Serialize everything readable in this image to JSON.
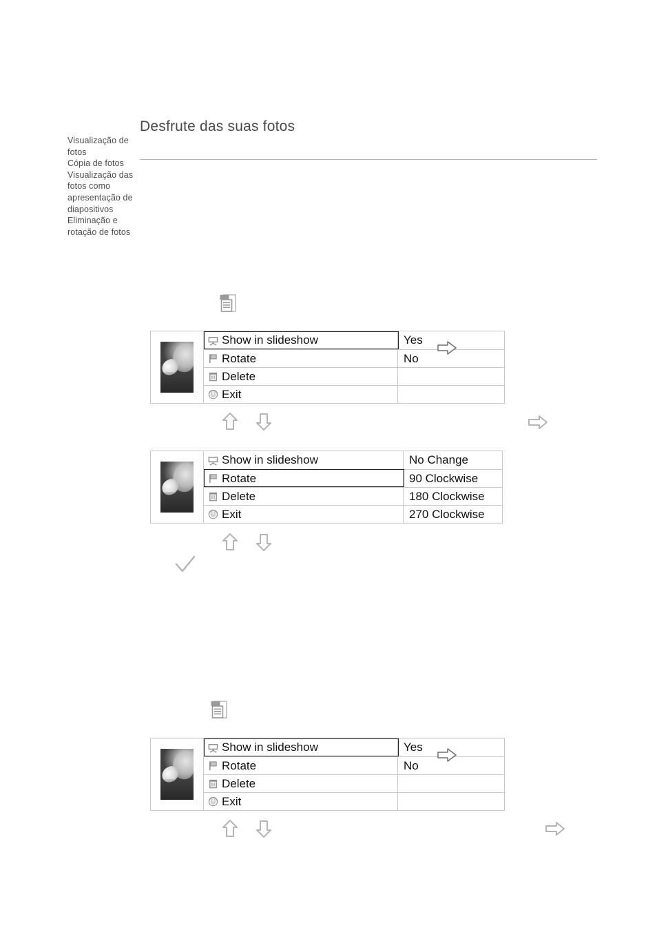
{
  "header": {
    "title": "Desfrute das suas fotos"
  },
  "sidebar": {
    "items": [
      {
        "label": "Visualização de fotos"
      },
      {
        "label": "Cópia de fotos"
      },
      {
        "label": "Visualização das fotos como apresentação de diapositivos"
      },
      {
        "label": "Eliminação e rotação de fotos"
      }
    ]
  },
  "colors": {
    "text_dark": "#111111",
    "title_gray": "#4a4a4a",
    "sidebar_gray": "#4c4c4c",
    "table_border": "#c8c8c8",
    "selection_border": "#1d1d1d",
    "icon_gray": "#9a9a9a"
  },
  "icons": {
    "menu_document": "document-menu-icon",
    "arrow_up": "arrow-up-icon",
    "arrow_down": "arrow-down-icon",
    "arrow_right": "arrow-right-icon",
    "check": "check-icon",
    "slideshow": "slideshow-projector-icon",
    "rotate": "flag-icon",
    "delete": "trash-icon",
    "exit": "power-icon"
  },
  "menus": [
    {
      "id": "menu-1",
      "rows": [
        {
          "icon": "slideshow-projector-icon",
          "label": "Show in slideshow",
          "value": "Yes",
          "selected": true
        },
        {
          "icon": "flag-icon",
          "label": "Rotate",
          "value": "No",
          "selected": false
        },
        {
          "icon": "trash-icon",
          "label": "Delete",
          "value": "",
          "selected": false
        },
        {
          "icon": "power-icon",
          "label": "Exit",
          "value": "",
          "selected": false
        }
      ]
    },
    {
      "id": "menu-2",
      "rows": [
        {
          "icon": "slideshow-projector-icon",
          "label": "Show in slideshow",
          "value": "No Change",
          "selected": false
        },
        {
          "icon": "flag-icon",
          "label": "Rotate",
          "value": "90 Clockwise",
          "selected": true
        },
        {
          "icon": "trash-icon",
          "label": "Delete",
          "value": "180 Clockwise",
          "selected": false
        },
        {
          "icon": "power-icon",
          "label": "Exit",
          "value": "270 Clockwise",
          "selected": false
        }
      ]
    },
    {
      "id": "menu-3",
      "rows": [
        {
          "icon": "slideshow-projector-icon",
          "label": "Show in slideshow",
          "value": "Yes",
          "selected": true
        },
        {
          "icon": "flag-icon",
          "label": "Rotate",
          "value": "No",
          "selected": false
        },
        {
          "icon": "trash-icon",
          "label": "Delete",
          "value": "",
          "selected": false
        },
        {
          "icon": "power-icon",
          "label": "Exit",
          "value": "",
          "selected": false
        }
      ]
    }
  ]
}
